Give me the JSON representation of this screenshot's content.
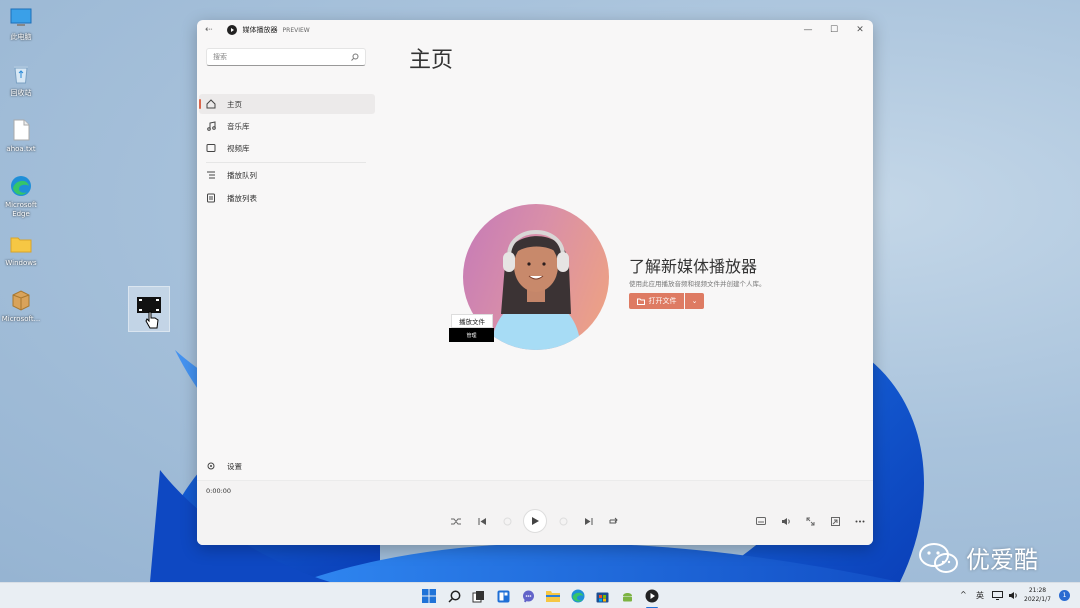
{
  "desktop": {
    "icons": [
      {
        "label": "此电脑",
        "icon": "computer-icon"
      },
      {
        "label": "回收站",
        "icon": "recycle-bin-icon"
      },
      {
        "label": "ahoa.txt",
        "icon": "document-icon"
      },
      {
        "label": "Microsoft Edge",
        "icon": "edge-icon"
      },
      {
        "label": "Windows",
        "icon": "folder-icon"
      },
      {
        "label": "Microsoft...",
        "icon": "package-icon"
      }
    ]
  },
  "window": {
    "app_title": "媒体播放器",
    "preview_badge": "PREVIEW",
    "controls": {
      "minimize": "—",
      "maximize": "☐",
      "close": "✕"
    }
  },
  "sidebar": {
    "search_placeholder": "搜索",
    "nav_items": [
      {
        "label": "主页",
        "icon": "home-icon",
        "active": true
      },
      {
        "label": "音乐库",
        "icon": "music-note-icon",
        "active": false
      },
      {
        "label": "视频库",
        "icon": "video-icon",
        "active": false
      },
      {
        "label": "播放队列",
        "icon": "queue-icon",
        "active": false
      },
      {
        "label": "播放列表",
        "icon": "playlist-icon",
        "active": false
      }
    ],
    "settings_label": "设置"
  },
  "main": {
    "page_title": "主页",
    "hero_title": "了解新媒体播放器",
    "hero_desc": "使用此应用播放音频和视频文件并创建个人库。",
    "open_file_label": "打开文件",
    "open_file_dropdown": "⌄",
    "tooltip": "播放文件",
    "tooltip_sub": "管理"
  },
  "player": {
    "time": "0:00:00"
  },
  "taskbar": {
    "tray_lang": "英",
    "time": "21:28",
    "date": "2022/1/7",
    "notification_count": "1"
  },
  "watermark": {
    "text": "优爱酷"
  },
  "colors": {
    "accent": "#de7b63",
    "window_bg": "#f8f7f7",
    "taskbar_bg": "#e9eef3"
  }
}
